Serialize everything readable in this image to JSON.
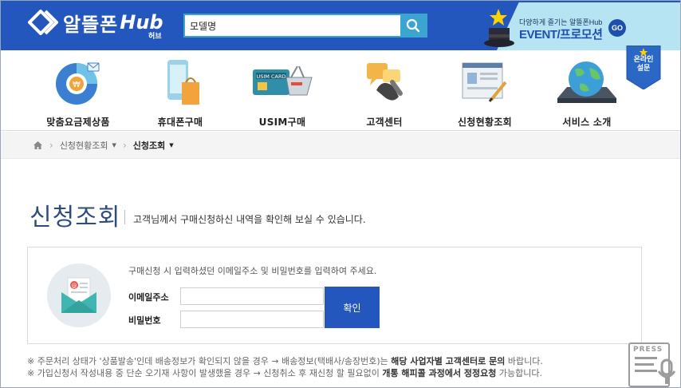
{
  "header": {
    "logo_text": "알뜰폰",
    "logo_hub": "Hub",
    "logo_sub": "허브",
    "search": {
      "value": "모델명",
      "placeholder": ""
    },
    "event": {
      "small": "다양하게 즐기는 알뜰폰Hub",
      "big": "EVENT/프로모션",
      "go": "GO"
    }
  },
  "nav": {
    "items": [
      {
        "label": "맞춤요금제상품",
        "icon": "plan-icon"
      },
      {
        "label": "휴대폰구매",
        "icon": "phone-bag-icon"
      },
      {
        "label": "USIM구매",
        "icon": "usim-card-icon"
      },
      {
        "label": "고객센터",
        "icon": "customer-center-icon"
      },
      {
        "label": "신청현황조회",
        "icon": "application-status-icon"
      },
      {
        "label": "서비스 소개",
        "icon": "globe-icon"
      }
    ],
    "survey_badge": {
      "line1": "온라인",
      "line2": "설문"
    }
  },
  "breadcrumb": {
    "items": [
      {
        "label": "신청현황조회"
      },
      {
        "label": "신청조회"
      }
    ]
  },
  "page": {
    "title": "신청조회",
    "description": "고객님께서 구매신청하신 내역을 확인해 보실 수 있습니다."
  },
  "form": {
    "hint": "구매신청 시 입력하셨던 이메일주소 및 비밀번호를 입력하여 주세요.",
    "email_label": "이메일주소",
    "email_value": "",
    "password_label": "비밀번호",
    "password_value": "",
    "confirm_label": "확인"
  },
  "notes": {
    "line1_prefix": "※ 주문처리 상태가 '상품발송'인데 배송정보가 확인되지 않을 경우 → 배송정보(택배사/송장번호)는 ",
    "line1_bold": "해당 사업자별 고객센터로 문의",
    "line1_suffix": " 바랍니다.",
    "line2_prefix": "※ 가입신청서 작성내용 중 단순 오기재 사항이 발생했을 경우 → 신청취소 후 재신청 할 필요없이 ",
    "line2_bold": "개통 해피콜 과정에서 정정요청",
    "line2_suffix": " 가능합니다."
  },
  "press_badge": {
    "label": "PRESS"
  },
  "colors": {
    "brand_blue": "#2457bd",
    "search_accent": "#3ba4d0",
    "title_navy": "#2d4c7c"
  }
}
